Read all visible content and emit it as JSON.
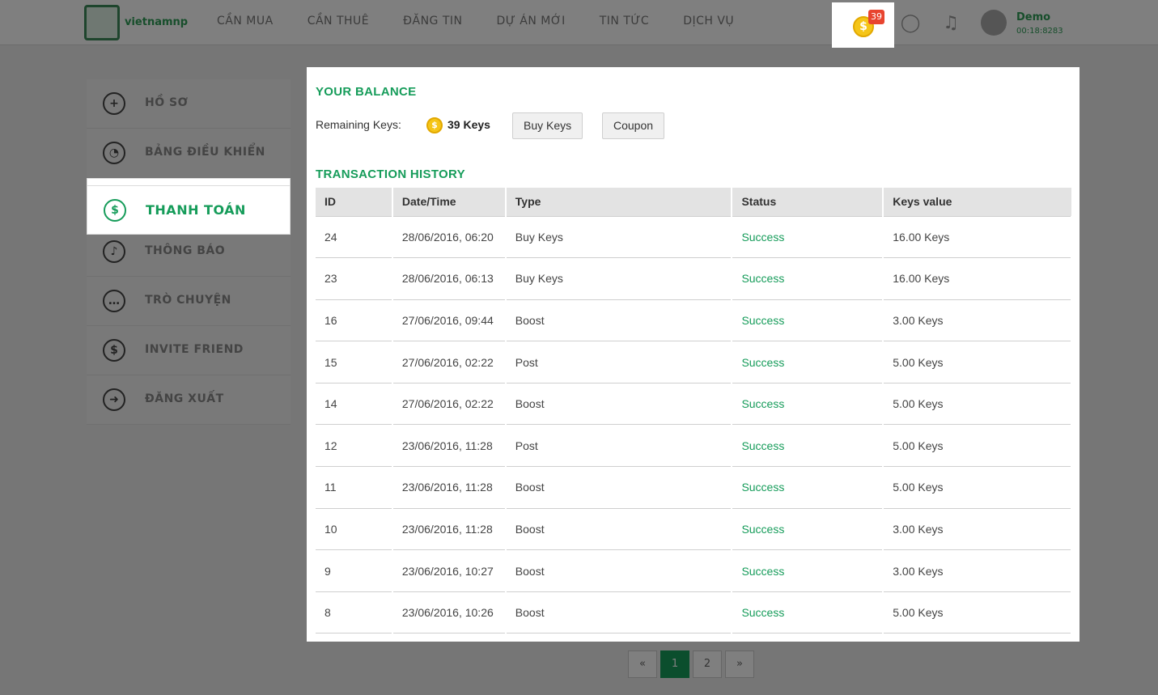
{
  "header": {
    "logo_text": "vietnamnp",
    "nav": [
      "CẦN MUA",
      "CẦN THUÊ",
      "ĐĂNG TIN",
      "DỰ ÁN MỚI",
      "TIN TỨC",
      "DỊCH VỤ"
    ],
    "coin_glyph": "$",
    "coin_count": "39",
    "user_name": "Demo",
    "user_sub": "00:18:8283"
  },
  "sidebar": {
    "items": [
      {
        "icon": "plus-icon",
        "glyph": "+",
        "label": "HỒ SƠ"
      },
      {
        "icon": "dashboard-icon",
        "glyph": "◔",
        "label": "BẢNG ĐIỀU KHIỂN"
      },
      {
        "icon": "dollar-icon",
        "glyph": "$",
        "label": "THANH TOÁN"
      },
      {
        "icon": "bell-icon",
        "glyph": "♪",
        "label": "THÔNG BÁO"
      },
      {
        "icon": "chat-icon",
        "glyph": "…",
        "label": "TRÒ CHUYỆN"
      },
      {
        "icon": "invite-icon",
        "glyph": "$",
        "label": "INVITE FRIEND"
      },
      {
        "icon": "logout-icon",
        "glyph": "➜",
        "label": "ĐĂNG XUẤT"
      }
    ]
  },
  "balance": {
    "title": "YOUR BALANCE",
    "remaining_label": "Remaining Keys:",
    "coin_glyph": "$",
    "remaining_value": "39 Keys",
    "buy_label": "Buy Keys",
    "coupon_label": "Coupon"
  },
  "history": {
    "title": "TRANSACTION HISTORY",
    "columns": [
      "ID",
      "Date/Time",
      "Type",
      "Status",
      "Keys value"
    ],
    "rows": [
      [
        "24",
        "28/06/2016, 06:20",
        "Buy Keys",
        "Success",
        "16.00 Keys"
      ],
      [
        "23",
        "28/06/2016, 06:13",
        "Buy Keys",
        "Success",
        "16.00 Keys"
      ],
      [
        "16",
        "27/06/2016, 09:44",
        "Boost",
        "Success",
        "3.00 Keys"
      ],
      [
        "15",
        "27/06/2016, 02:22",
        "Post",
        "Success",
        "5.00 Keys"
      ],
      [
        "14",
        "27/06/2016, 02:22",
        "Boost",
        "Success",
        "5.00 Keys"
      ],
      [
        "12",
        "23/06/2016, 11:28",
        "Post",
        "Success",
        "5.00 Keys"
      ],
      [
        "11",
        "23/06/2016, 11:28",
        "Boost",
        "Success",
        "5.00 Keys"
      ],
      [
        "10",
        "23/06/2016, 11:28",
        "Boost",
        "Success",
        "3.00 Keys"
      ],
      [
        "9",
        "23/06/2016, 10:27",
        "Boost",
        "Success",
        "3.00 Keys"
      ],
      [
        "8",
        "23/06/2016, 10:26",
        "Boost",
        "Success",
        "5.00 Keys"
      ]
    ]
  },
  "pagination": {
    "prev": "«",
    "pages": [
      "1",
      "2"
    ],
    "next": "»"
  },
  "colors": {
    "accent": "#169c5a",
    "badge": "#e8442f",
    "coin": "#f5c518"
  }
}
